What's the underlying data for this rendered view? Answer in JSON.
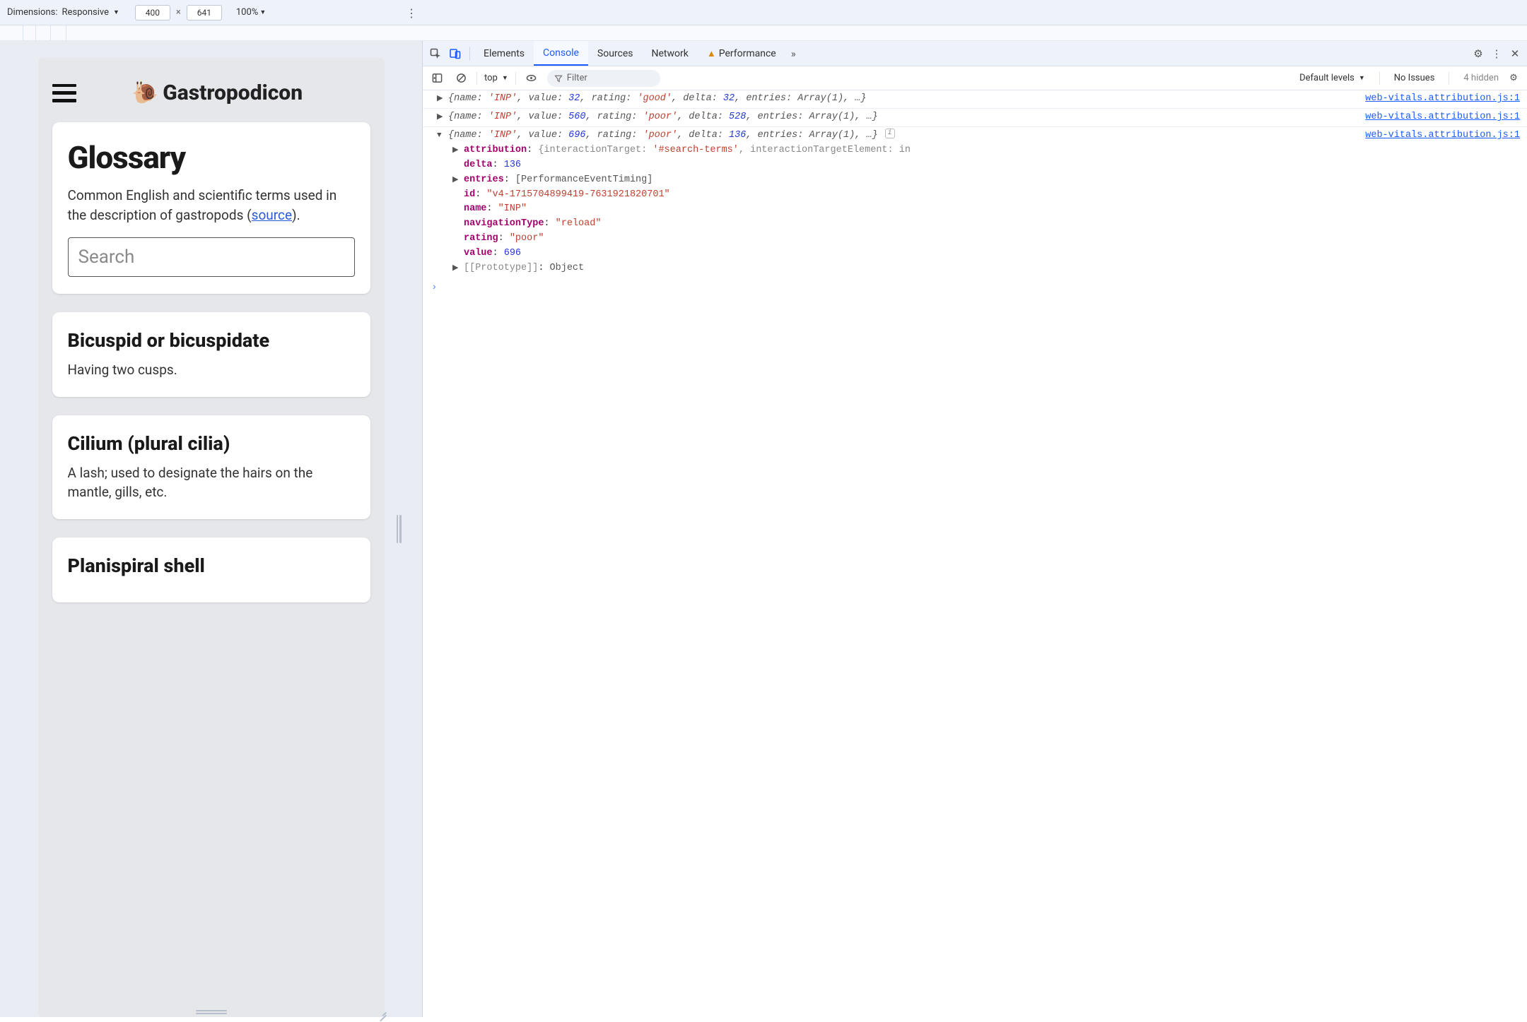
{
  "toolbar": {
    "dimensions_label": "Dimensions:",
    "device_label": "Responsive",
    "width": "400",
    "height": "641",
    "zoom": "100%"
  },
  "page": {
    "brand": "Gastropodicon",
    "glossary_title": "Glossary",
    "glossary_lead_a": "Common English and scientific terms used in the description of gastropods (",
    "glossary_source": "source",
    "glossary_lead_b": ").",
    "search_placeholder": "Search",
    "entries": [
      {
        "term": "Bicuspid or bicuspidate",
        "def": "Having two cusps."
      },
      {
        "term": "Cilium (plural cilia)",
        "def": "A lash; used to designate the hairs on the mantle, gills, etc."
      },
      {
        "term": "Planispiral shell",
        "def": ""
      }
    ]
  },
  "devtools": {
    "tabs": {
      "elements": "Elements",
      "console": "Console",
      "sources": "Sources",
      "network": "Network",
      "performance": "Performance"
    },
    "subbar": {
      "context": "top",
      "filter_placeholder": "Filter",
      "levels": "Default levels",
      "no_issues": "No Issues",
      "hidden": "4 hidden"
    },
    "source_link": "web-vitals.attribution.js:1",
    "log1": {
      "name": "'INP'",
      "value": "32",
      "rating": "'good'",
      "delta": "32",
      "entries": "Array(1)"
    },
    "log2": {
      "name": "'INP'",
      "value": "560",
      "rating": "'poor'",
      "delta": "528",
      "entries": "Array(1)"
    },
    "log3": {
      "name": "'INP'",
      "value": "696",
      "rating": "'poor'",
      "delta": "136",
      "entries": "Array(1)",
      "exp": {
        "attr_target": "'#search-terms'",
        "attr_elem": "in",
        "delta": "136",
        "entries": "[PerformanceEventTiming]",
        "id": "\"v4-1715704899419-7631921820701\"",
        "name_v": "\"INP\"",
        "nav": "\"reload\"",
        "rating": "\"poor\"",
        "value": "696",
        "proto": "Object"
      }
    }
  }
}
